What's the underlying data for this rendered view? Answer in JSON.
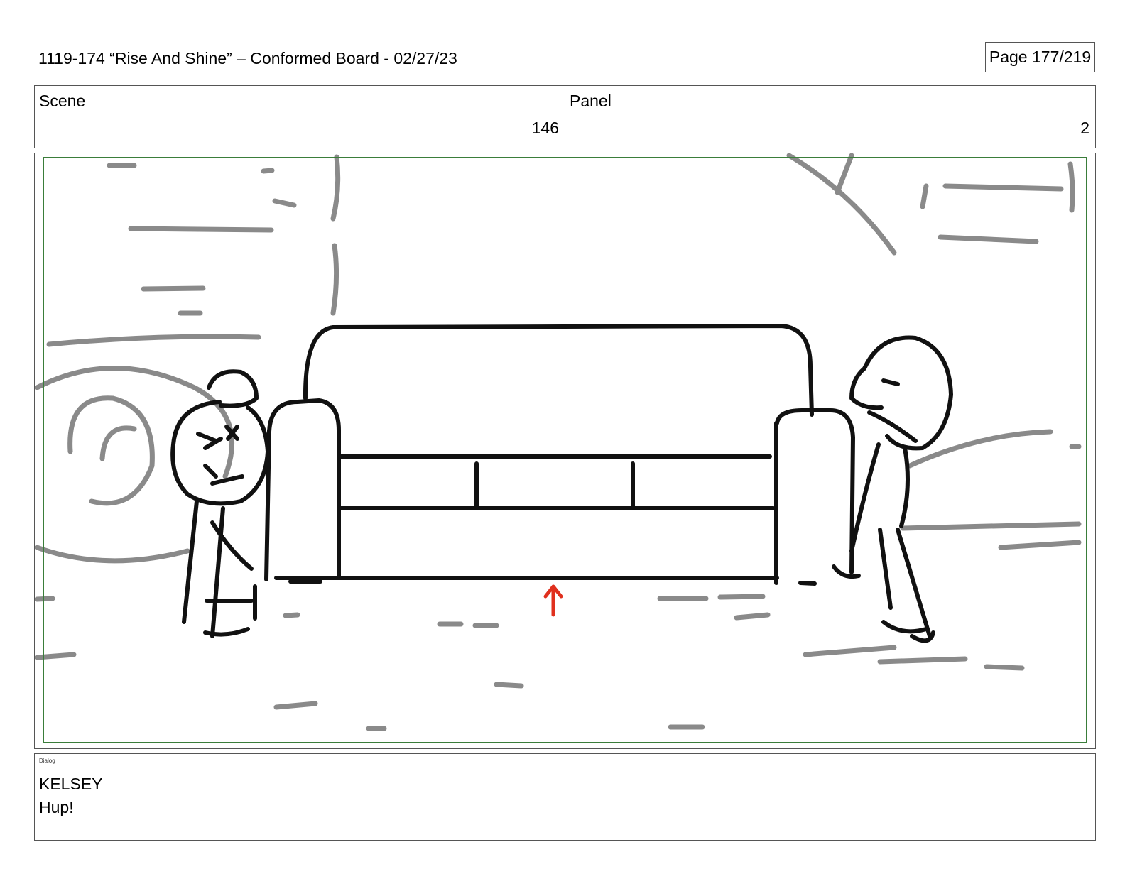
{
  "header": {
    "title": "1119-174 “Rise And Shine” – Conformed Board - 02/27/23",
    "page": "Page 177/219"
  },
  "scene": {
    "label": "Scene",
    "value": "146"
  },
  "panel": {
    "label": "Panel",
    "value": "2"
  },
  "frame": {
    "border_color": "#3a7d3a",
    "sketch_color": "#8a8a8a",
    "line_color": "#111111",
    "arrow_color": "#e0301e"
  },
  "dialog": {
    "label": "Dialog",
    "character": "KELSEY",
    "line": "Hup!"
  }
}
